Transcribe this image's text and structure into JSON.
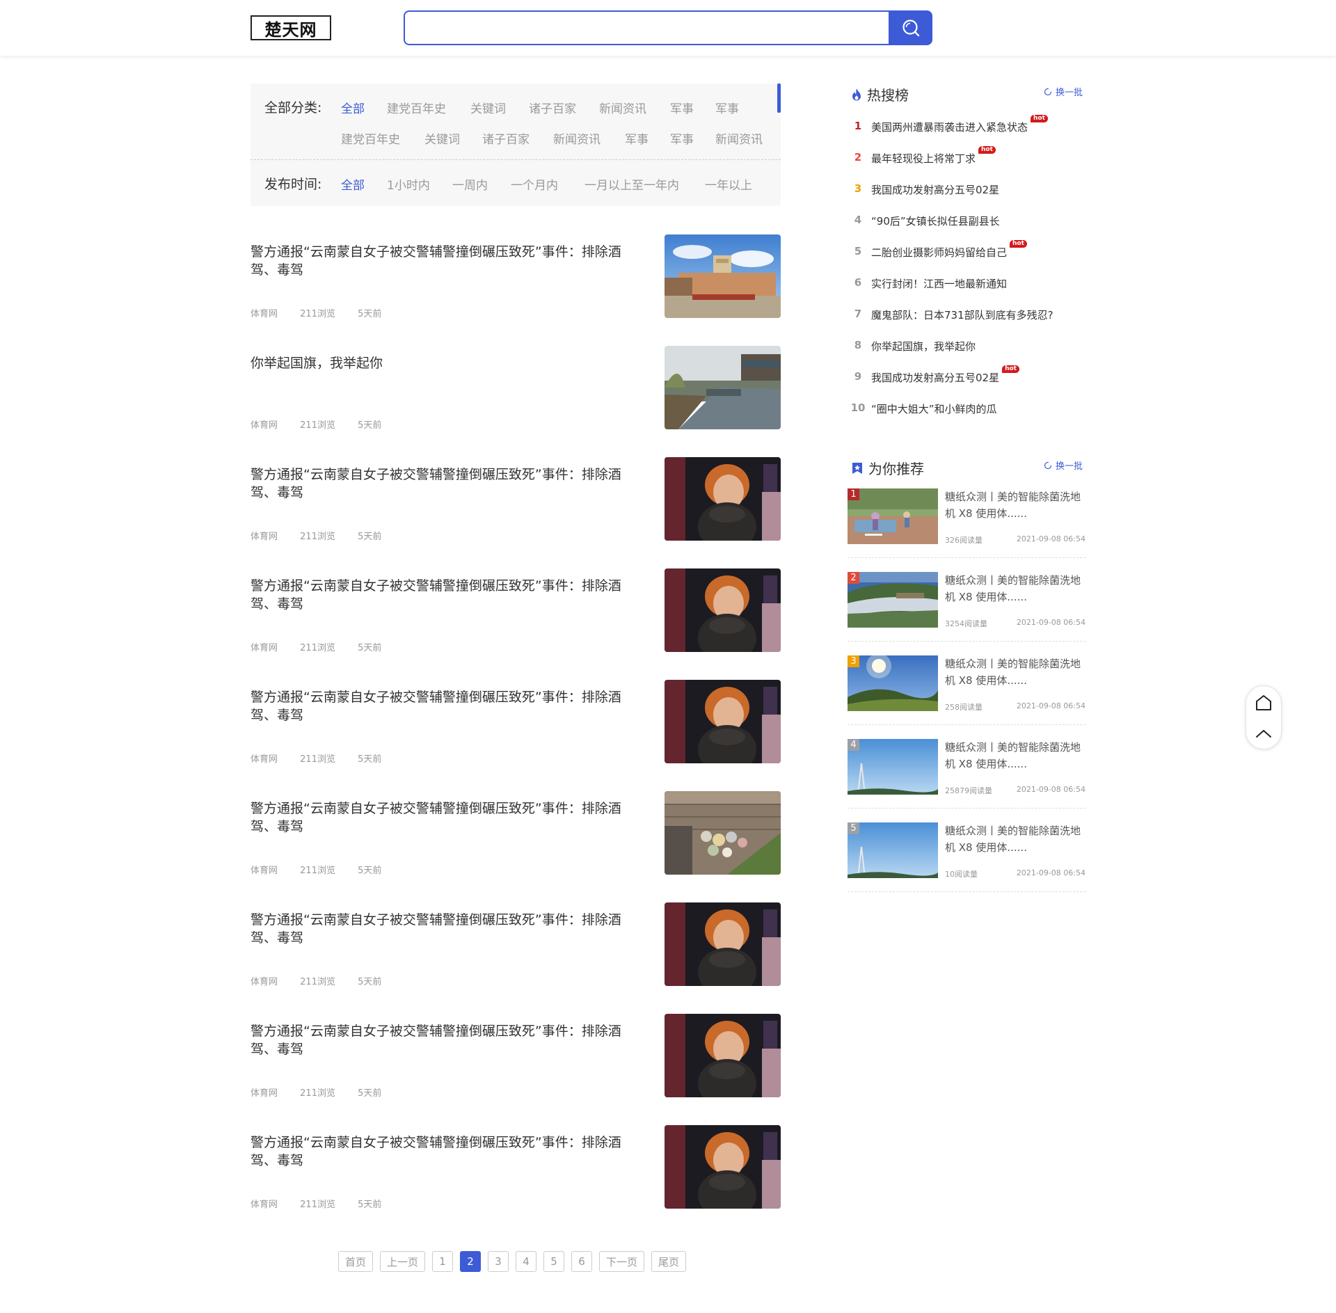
{
  "header": {
    "logo": "楚天网",
    "search_placeholder": ""
  },
  "filter": {
    "category_label": "全部分类:",
    "categories_row1": [
      "全部",
      "建党百年史",
      "关键词",
      "诸子百家",
      "新闻资讯",
      "军事",
      "军事"
    ],
    "categories_row2": [
      "建党百年史",
      "关键词",
      "诸子百家",
      "新闻资讯",
      "军事",
      "军事",
      "新闻资讯"
    ],
    "time_label": "发布时间:",
    "times": [
      "全部",
      "1小时内",
      "一周内",
      "一个月内",
      "一月以上至一年内",
      "一年以上"
    ],
    "active_category": "全部",
    "active_time": "全部"
  },
  "articles": [
    {
      "title": "警方通报“云南蒙自女子被交警辅警撞倒碾压致死”事件：排除酒驾、毒驾",
      "source": "体育网",
      "views": "211浏览",
      "time": "5天前",
      "image": "building"
    },
    {
      "title": "你举起国旗，我举起你",
      "source": "体育网",
      "views": "211浏览",
      "time": "5天前",
      "image": "lake"
    },
    {
      "title": "警方通报“云南蒙自女子被交警辅警撞倒碾压致死”事件：排除酒驾、毒驾",
      "source": "体育网",
      "views": "211浏览",
      "time": "5天前",
      "image": "portrait"
    },
    {
      "title": "警方通报“云南蒙自女子被交警辅警撞倒碾压致死”事件：排除酒驾、毒驾",
      "source": "体育网",
      "views": "211浏览",
      "time": "5天前",
      "image": "portrait"
    },
    {
      "title": "警方通报“云南蒙自女子被交警辅警撞倒碾压致死”事件：排除酒驾、毒驾",
      "source": "体育网",
      "views": "211浏览",
      "time": "5天前",
      "image": "portrait"
    },
    {
      "title": "警方通报“云南蒙自女子被交警辅警撞倒碾压致死”事件：排除酒驾、毒驾",
      "source": "体育网",
      "views": "211浏览",
      "time": "5天前",
      "image": "flowers"
    },
    {
      "title": "警方通报“云南蒙自女子被交警辅警撞倒碾压致死”事件：排除酒驾、毒驾",
      "source": "体育网",
      "views": "211浏览",
      "time": "5天前",
      "image": "portrait"
    },
    {
      "title": "警方通报“云南蒙自女子被交警辅警撞倒碾压致死”事件：排除酒驾、毒驾",
      "source": "体育网",
      "views": "211浏览",
      "time": "5天前",
      "image": "portrait"
    },
    {
      "title": "警方通报“云南蒙自女子被交警辅警撞倒碾压致死”事件：排除酒驾、毒驾",
      "source": "体育网",
      "views": "211浏览",
      "time": "5天前",
      "image": "portrait"
    }
  ],
  "pagination": {
    "first": "首页",
    "prev": "上一页",
    "pages": [
      "1",
      "2",
      "3",
      "4",
      "5",
      "6"
    ],
    "current": "2",
    "next": "下一页",
    "last": "尾页"
  },
  "hot": {
    "title": "热搜榜",
    "refresh": "换一批",
    "badge": "hot",
    "items": [
      {
        "rank": "1",
        "text": "美国两州遭暴雨袭击进入紧急状态",
        "hot": true
      },
      {
        "rank": "2",
        "text": "最年轻现役上将常丁求",
        "hot": true
      },
      {
        "rank": "3",
        "text": "我国成功发射高分五号02星",
        "hot": false
      },
      {
        "rank": "4",
        "text": "“90后”女镇长拟任县副县长",
        "hot": false
      },
      {
        "rank": "5",
        "text": "二胎创业摄影师妈妈留给自己",
        "hot": true
      },
      {
        "rank": "6",
        "text": "实行封闭！江西一地最新通知",
        "hot": false
      },
      {
        "rank": "7",
        "text": "魔鬼部队：日本731部队到底有多残忍?",
        "hot": false
      },
      {
        "rank": "8",
        "text": "你举起国旗，我举起你",
        "hot": false
      },
      {
        "rank": "9",
        "text": "我国成功发射高分五号02星",
        "hot": true
      },
      {
        "rank": "10",
        "text": "“圈中大姐大”和小鲜肉的瓜",
        "hot": false
      }
    ]
  },
  "recommend": {
    "title": "为你推荐",
    "refresh": "换一批",
    "items": [
      {
        "rank": "1",
        "title": "糖纸众测丨美的智能除菌洗地机 X8 使用体......",
        "reads": "326阅读量",
        "date": "2021-09-08 06:54",
        "image": "park",
        "rank_color": "#b52a2a"
      },
      {
        "rank": "2",
        "title": "糖纸众测丨美的智能除菌洗地机 X8 使用体......",
        "reads": "3254阅读量",
        "date": "2021-09-08 06:54",
        "image": "valley",
        "rank_color": "#e04a3a"
      },
      {
        "rank": "3",
        "title": "糖纸众测丨美的智能除菌洗地机 X8 使用体......",
        "reads": "258阅读量",
        "date": "2021-09-08 06:54",
        "image": "sky-sun",
        "rank_color": "#f0a000"
      },
      {
        "rank": "4",
        "title": "糖纸众测丨美的智能除菌洗地机 X8 使用体......",
        "reads": "25879阅读量",
        "date": "2021-09-08 06:54",
        "image": "sky-tower",
        "rank_color": "#9aa0a6"
      },
      {
        "rank": "5",
        "title": "糖纸众测丨美的智能除菌洗地机 X8 使用体......",
        "reads": "10阅读量",
        "date": "2021-09-08 06:54",
        "image": "sky-tower",
        "rank_color": "#9aa0a6"
      }
    ]
  },
  "colors": {
    "accent": "#3d5bd6",
    "hot_badge": "#d41a1a"
  }
}
